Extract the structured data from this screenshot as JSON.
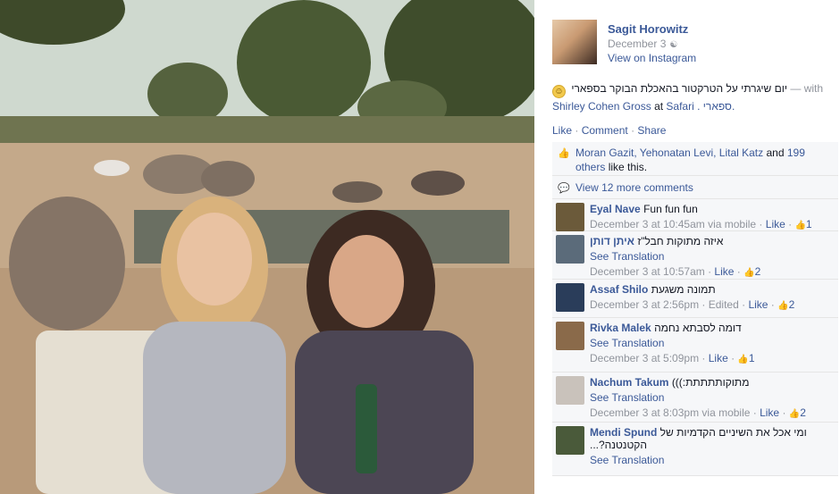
{
  "post": {
    "author": "Sagit Horowitz",
    "date": "December 3",
    "audience_icon": "friends-icon",
    "view_on_instagram": "View on Instagram",
    "caption": {
      "emoji": "smile-emoji",
      "text": "יום שיגרתי על הטרקטור בהאכלת הבוקר בספארי",
      "with_text": "— with",
      "tagged": "Shirley Cohen Gross",
      "at_text": "at",
      "place": "Safari",
      "place_suffix": ". ספארי."
    },
    "actions": {
      "like": "Like",
      "sep1": "·",
      "comment": "Comment",
      "sep2": "·",
      "share": "Share"
    }
  },
  "likes": {
    "names": "Moran Gazit, Yehonatan Levi, Lital Katz",
    "and_text": "and",
    "others": "199 others",
    "suffix": "like this."
  },
  "view_more_comments": "View 12 more comments",
  "comments": [
    {
      "author": "Eyal Nave",
      "text": "Fun fun fun",
      "time": "December 3 at 10:45am via mobile",
      "like": "Like",
      "likes": "1",
      "avatar_color": "#6b5a3a"
    },
    {
      "author": "איתן דותן",
      "text": "איזה מתוקות חבל\"ז",
      "see_translation": "See Translation",
      "time": "December 3 at 10:57am",
      "like": "Like",
      "likes": "2",
      "avatar_color": "#5b6b7a"
    },
    {
      "author": "Assaf Shilo",
      "text": "תמונה משגעת",
      "time": "December 3 at 2:56pm",
      "edited": "Edited",
      "like": "Like",
      "likes": "2",
      "avatar_color": "#2a3d5a"
    },
    {
      "author": "Rivka Malek",
      "text": "דומה לסבתא נחמה",
      "see_translation": "See Translation",
      "time": "December 3 at 5:09pm",
      "like": "Like",
      "likes": "1",
      "avatar_color": "#8a6a4a"
    },
    {
      "author": "Nachum Takum",
      "text": "מתוקותתתתת:)))",
      "see_translation": "See Translation",
      "time": "December 3 at 8:03pm via mobile",
      "like": "Like",
      "likes": "2",
      "avatar_color": "#c9c2bb"
    },
    {
      "author": "Mendi Spund",
      "text": "ומי אכל את השיניים הקדמיות של הקטנטנה?...",
      "see_translation": "See Translation",
      "avatar_color": "#4a5a3a"
    }
  ]
}
